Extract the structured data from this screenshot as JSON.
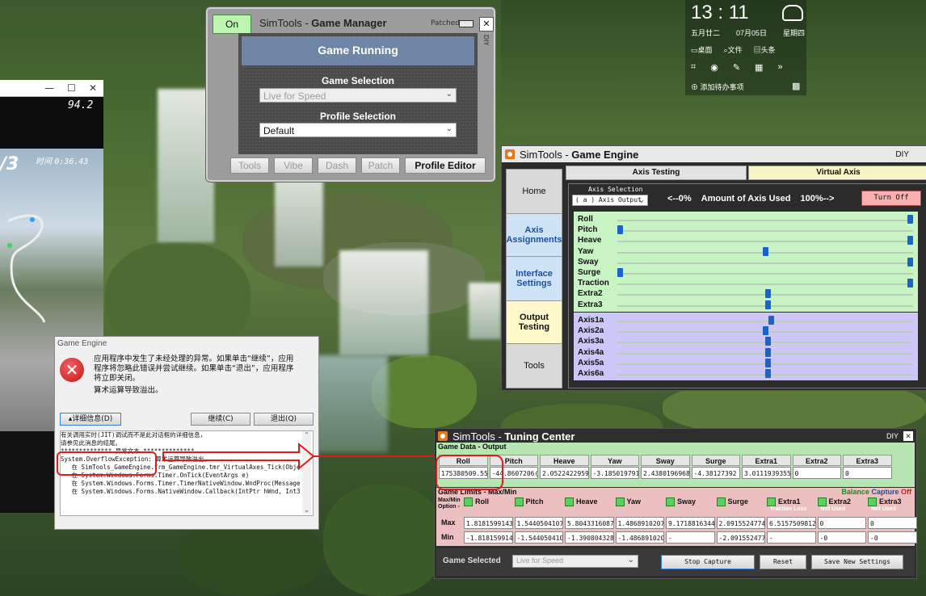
{
  "clock": {
    "time": "13 : 11",
    "lunar": "五月廿二",
    "date": "07月05日",
    "weekday": "星期四",
    "shortcuts": [
      "桌面",
      "文件",
      "头条"
    ],
    "todo": "添加待办事项"
  },
  "game": {
    "speed": "94.2",
    "lap": "/3",
    "time_label": "时间",
    "time": "0:36.43"
  },
  "gm": {
    "status": "On",
    "title_prefix": "SimTools - ",
    "title_bold": "Game Manager",
    "patched": "Patched",
    "close": "✕",
    "diy": "DIY",
    "running": "Game Running",
    "game_selection": "Game Selection",
    "game_value": "Live for Speed",
    "profile_selection": "Profile Selection",
    "profile_value": "Default",
    "buttons": [
      "Tools",
      "Vibe",
      "Dash",
      "Patch"
    ],
    "profile_editor": "Profile Editor"
  },
  "ge": {
    "title_prefix": "SimTools - ",
    "title_bold": "Game Engine",
    "diy": "DIY",
    "nav": [
      "Home",
      "Axis Assignments",
      "Interface Settings",
      "Output Testing",
      "Tools"
    ],
    "tabs": [
      "Axis Testing",
      "Virtual Axis"
    ],
    "axis_selection_label": "Axis Selection",
    "axis_selection_value": "( a ) Axis Output",
    "range_low": "<--0%",
    "range_mid": "Amount of Axis Used",
    "range_high": "100%-->",
    "turn_off": "Turn Off",
    "axes": [
      {
        "name": "Roll",
        "pct": 100
      },
      {
        "name": "Pitch",
        "pct": 0
      },
      {
        "name": "Heave",
        "pct": 100
      },
      {
        "name": "Yaw",
        "pct": 50
      },
      {
        "name": "Sway",
        "pct": 100
      },
      {
        "name": "Surge",
        "pct": 0
      },
      {
        "name": "Traction",
        "pct": 100
      },
      {
        "name": "Extra2",
        "pct": 51
      },
      {
        "name": "Extra3",
        "pct": 51
      }
    ],
    "axes_out": [
      {
        "name": "Axis1a",
        "pct": 52
      },
      {
        "name": "Axis2a",
        "pct": 50
      },
      {
        "name": "Axis3a",
        "pct": 51
      },
      {
        "name": "Axis4a",
        "pct": 51
      },
      {
        "name": "Axis5a",
        "pct": 51
      },
      {
        "name": "Axis6a",
        "pct": 51
      }
    ]
  },
  "err": {
    "title": "Game Engine",
    "msg1": "应用程序中发生了未经处理的异常。如果单击“继续”，应用程序将忽略此错误并尝试继续。如果单击“退出”，应用程序将立即关闭。",
    "msg2": "算术运算导致溢出。",
    "details": "▴详细信息(D)",
    "continue": "继续(C)",
    "quit": "退出(Q)",
    "log": [
      "有关调用实时(JIT)调试而不是此对话框的详细信息，",
      "请参见此消息的结尾。",
      "",
      "************** 异常文本 **************",
      "System.OverflowException: 算术运算导致溢出。",
      "   在 SimTools_GameEngine.frm_GameEngine.tmr_VirtualAxes_Tick(Obje",
      "   在 System.Windows.Forms.Timer.OnTick(EventArgs e)",
      "   在 System.Windows.Forms.Timer.TimerNativeWindow.WndProc(Message",
      "   在 System.Windows.Forms.NativeWindow.Callback(IntPtr hWnd, Int3"
    ]
  },
  "tc": {
    "title_prefix": "SimTools - ",
    "title_bold": "Tuning Center",
    "diy": "DIY",
    "close": "✕",
    "game_data": "Game Data - Output",
    "cols": [
      "Roll",
      "Pitch",
      "Heave",
      "Yaw",
      "Sway",
      "Surge",
      "Extra1",
      "Extra2",
      "Extra3"
    ],
    "output": [
      "175380509.550",
      "-44.8607206(",
      "2.05224229592",
      "-3.185019791",
      "2.43801969683",
      "-4.38127392",
      "3.01119393555",
      "0",
      "0"
    ],
    "limits_label": "Game Limits - Max/Min",
    "balance": "Balance",
    "capture": "Capture",
    "off": "Off",
    "maxmin_option": "Max/Min Option -",
    "checks": [
      "Roll",
      "Pitch",
      "Heave",
      "Yaw",
      "Sway",
      "Surge",
      "Extra1",
      "Extra2",
      "Extra3"
    ],
    "sublabels": [
      "",
      "",
      "",
      "",
      "",
      "",
      "Traction Loss",
      "Not Used",
      "Not Used"
    ],
    "max_label": "Max",
    "min_label": "Min",
    "max": [
      "1.8181599143",
      "1.5440504107",
      "5.8043316087",
      "1.4868910207",
      "9.1718816344",
      "2.0915524774",
      "6.5157509812",
      "0",
      "0"
    ],
    "min": [
      "-1.818159914",
      "-1.544050410",
      "-1.390804328",
      "-1.486891020",
      "-",
      "-2.091552477",
      "-",
      "-0",
      "-0"
    ],
    "game_selected": "Game Selected",
    "game_selected_value": "Live for Speed",
    "stop_capture": "Stop Capture",
    "reset": "Reset",
    "save": "Save New Settings"
  },
  "colors": {
    "accent_green": "#b8e6b2",
    "accent_purple": "#c8c4f4",
    "red_mark": "#e01b1b",
    "thumb": "#1a63c9"
  }
}
